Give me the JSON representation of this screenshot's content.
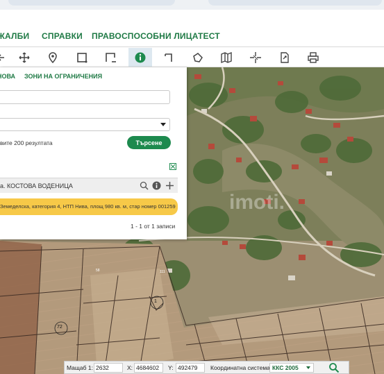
{
  "menu": {
    "items": [
      "ЖАЛБИ",
      "СПРАВКИ",
      "ПРАВОСПОСОБНИ ЛИЦА",
      "ТЕСТ"
    ]
  },
  "toolbar": {
    "tools": [
      {
        "icon": "arrow-left-icon"
      },
      {
        "icon": "pan-icon"
      },
      {
        "icon": "location-pin-icon"
      },
      {
        "icon": "select-rectangle-icon"
      },
      {
        "icon": "zoom-rectangle-icon"
      },
      {
        "icon": "info-icon",
        "active": true
      },
      {
        "icon": "measure-distance-icon"
      },
      {
        "icon": "measure-area-icon"
      },
      {
        "icon": "map-layers-icon"
      },
      {
        "icon": "crosshair-icon"
      },
      {
        "icon": "export-document-icon"
      },
      {
        "icon": "print-icon"
      }
    ]
  },
  "panel": {
    "tabs": [
      "НОВА",
      "ЗОНИ НА ОГРАНИЧЕНИЯ"
    ],
    "search_hint": "вите 200 резултата",
    "search_button": "Търсене",
    "result_title": "а. КОСТОВА ВОДЕНИЦА",
    "result_row": "Земеделска, категория 4, НТП Нива, площ 980 кв. м, стар номер 001259",
    "pager": "1 - 1 от 1 записи"
  },
  "map": {
    "watermark": "imoti.",
    "parcel_labels": [
      "1",
      "72",
      "111",
      "58"
    ]
  },
  "statusbar": {
    "scale_label": "Мащаб 1:",
    "scale_value": "2632",
    "x_label": "X:",
    "x_value": "4684602",
    "y_label": "Y:",
    "y_value": "492479",
    "crs_label": "Координатна система:",
    "crs_value": "ККС 2005"
  },
  "colors": {
    "accent": "#1f7a45",
    "button": "#1d8a4e",
    "highlight": "#f7c948"
  }
}
